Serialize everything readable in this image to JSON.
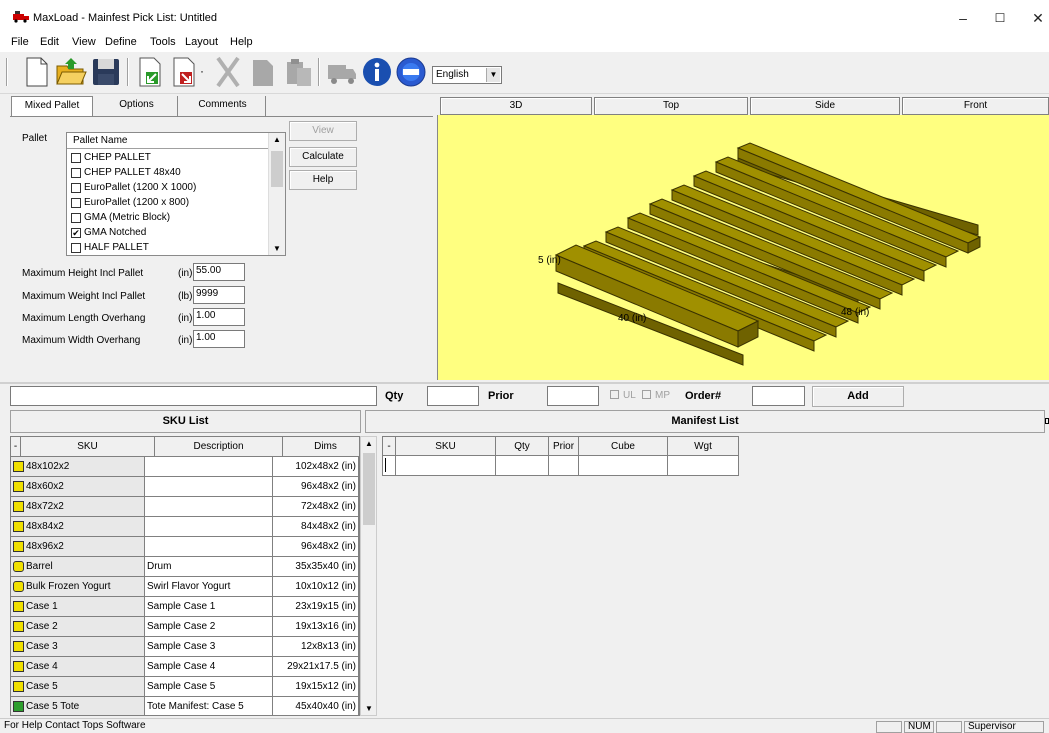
{
  "window": {
    "title": "MaxLoad - Mainfest Pick List: Untitled",
    "minimize": "–",
    "maximize": "☐",
    "close": "✕"
  },
  "menu": [
    "File",
    "Edit",
    "View",
    "Define",
    "Tools",
    "Layout",
    "Help"
  ],
  "toolbar": {
    "icons": [
      "new-icon",
      "open-icon",
      "save-icon",
      "import-icon",
      "export-icon",
      "cut-icon",
      "copy-icon",
      "paste-icon",
      "truck-icon",
      "info-icon",
      "help-icon"
    ],
    "language": "English"
  },
  "left_tabs": [
    "Mixed Pallet",
    "Options",
    "Comments"
  ],
  "pallet": {
    "label": "Pallet",
    "list_header": "Pallet Name",
    "items": [
      {
        "name": "CHEP PALLET",
        "checked": false
      },
      {
        "name": "CHEP PALLET 48x40",
        "checked": false
      },
      {
        "name": "EuroPallet (1200 X 1000)",
        "checked": false
      },
      {
        "name": "EuroPallet (1200 x 800)",
        "checked": false
      },
      {
        "name": "GMA (Metric Block)",
        "checked": false
      },
      {
        "name": "GMA Notched",
        "checked": true
      },
      {
        "name": "HALF PALLET",
        "checked": false
      }
    ],
    "check_mark": "✔"
  },
  "side_buttons": {
    "view": "View",
    "calculate": "Calculate",
    "help": "Help"
  },
  "limits": [
    {
      "label": "Maximum Height Incl Pallet",
      "unit": "(in)",
      "value": "55.00"
    },
    {
      "label": "Maximum Weight Incl Pallet",
      "unit": "(lb)",
      "value": "9999"
    },
    {
      "label": "Maximum Length Overhang",
      "unit": "(in)",
      "value": "1.00"
    },
    {
      "label": "Maximum Width Overhang",
      "unit": "(in)",
      "value": "1.00"
    }
  ],
  "view_tabs": [
    "3D",
    "Top",
    "Side",
    "Front"
  ],
  "viewer": {
    "height_label": "5 (in)",
    "length_label": "40 (in)",
    "width_label": "48 (in)",
    "background": "#ffff80",
    "pallet_color": "#8a7a00"
  },
  "entry_strip": {
    "qty_label": "Qty",
    "prior_label": "Prior",
    "ul_label": "UL",
    "mp_label": "MP",
    "order_label": "Order#",
    "add_label": "Add"
  },
  "sku_list": {
    "title": "SKU List",
    "columns": [
      "-",
      "SKU",
      "Description",
      "Dims"
    ],
    "rows": [
      {
        "sku": "48x102x2",
        "desc": "",
        "dims": "102x48x2 (in)",
        "icon": "box"
      },
      {
        "sku": "48x60x2",
        "desc": "",
        "dims": "96x48x2 (in)",
        "icon": "box"
      },
      {
        "sku": "48x72x2",
        "desc": "",
        "dims": "72x48x2 (in)",
        "icon": "box"
      },
      {
        "sku": "48x84x2",
        "desc": "",
        "dims": "84x48x2 (in)",
        "icon": "box"
      },
      {
        "sku": "48x96x2",
        "desc": "",
        "dims": "96x48x2 (in)",
        "icon": "box"
      },
      {
        "sku": "Barrel",
        "desc": "Drum",
        "dims": "35x35x40 (in)",
        "icon": "cylinder"
      },
      {
        "sku": "Bulk Frozen Yogurt",
        "desc": "Swirl Flavor Yogurt",
        "dims": "10x10x12 (in)",
        "icon": "cylinder"
      },
      {
        "sku": "Case 1",
        "desc": "Sample Case 1",
        "dims": "23x19x15 (in)",
        "icon": "box"
      },
      {
        "sku": "Case 2",
        "desc": "Sample Case 2",
        "dims": "19x13x16 (in)",
        "icon": "box"
      },
      {
        "sku": "Case 3",
        "desc": "Sample Case 3",
        "dims": "12x8x13 (in)",
        "icon": "box"
      },
      {
        "sku": "Case 4",
        "desc": "Sample Case 4",
        "dims": "29x21x17.5 (in)",
        "icon": "box"
      },
      {
        "sku": "Case 5",
        "desc": "Sample Case 5",
        "dims": "19x15x12 (in)",
        "icon": "box"
      },
      {
        "sku": "Case 5 Tote",
        "desc": "Tote Manifest: Case 5",
        "dims": "45x40x40 (in)",
        "icon": "tote"
      }
    ]
  },
  "manifest_list": {
    "title": "Manifest List",
    "columns": [
      "-",
      "SKU",
      "Qty",
      "Prior",
      "Cube",
      "Wgt"
    ]
  },
  "status": {
    "text": "For Help Contact Tops Software",
    "num": "NUM",
    "user": "Supervisor"
  }
}
